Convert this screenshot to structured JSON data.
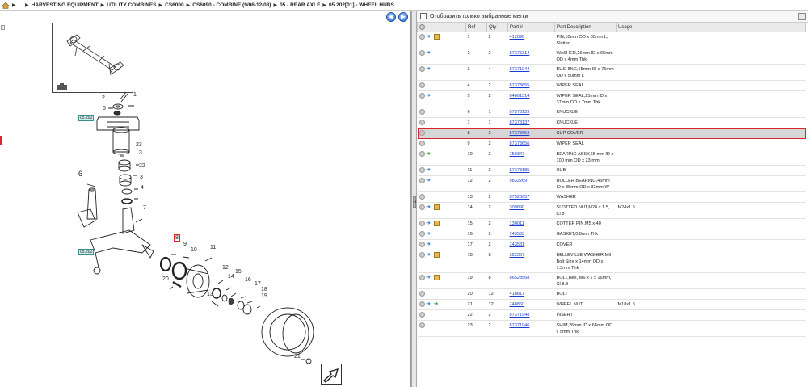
{
  "breadcrumb": {
    "prefix": "...",
    "items": [
      "HARVESTING EQUIPMENT",
      "UTILITY COMBINES",
      "CS6000",
      "CS6090 - COMBINE (9/06-12/08)",
      "05 - REAR AXLE",
      "05.202[01] - WHEEL HUBS"
    ]
  },
  "filter": {
    "label": "Отобразить только выбранные метки"
  },
  "table": {
    "columns": [
      "Ref",
      "Qty",
      "Part #",
      "Part Description",
      "Usage"
    ],
    "rows": [
      {
        "ref": "1",
        "qty": "2",
        "part": "412690",
        "desc": "PIN,10mm OD x 65mm L, Slotted",
        "usage": "",
        "icons": [
          "gray",
          "blue",
          "box"
        ]
      },
      {
        "ref": "2",
        "qty": "2",
        "part": "87375314",
        "desc": "WASHER,26mm ID x 65mm OD x 4mm Thk",
        "usage": "",
        "icons": [
          "gray",
          "blue"
        ]
      },
      {
        "ref": "3",
        "qty": "4",
        "part": "87371944",
        "desc": "BUSHING,65mm ID x 75mm OD x 50mm L",
        "usage": "",
        "icons": [
          "gray",
          "blue"
        ]
      },
      {
        "ref": "4",
        "qty": "2",
        "part": "87373655",
        "desc": "WIPER SEAL",
        "usage": "",
        "icons": [
          "gray"
        ]
      },
      {
        "ref": "5",
        "qty": "2",
        "part": "84801314",
        "desc": "WIPER SEAL,25mm ID x 37mm OD x 7mm Thk",
        "usage": "",
        "icons": [
          "gray",
          "blue"
        ]
      },
      {
        "ref": "6",
        "qty": "1",
        "part": "87373139",
        "desc": "KNUCKLE",
        "usage": "",
        "icons": [
          "gray"
        ]
      },
      {
        "ref": "7",
        "qty": "1",
        "part": "87373137",
        "desc": "KNUCKLE",
        "usage": "",
        "icons": [
          "gray"
        ]
      },
      {
        "ref": "8",
        "qty": "2",
        "part": "87373653",
        "desc": "CUP COVER",
        "usage": "",
        "icons": [
          "gray"
        ],
        "selected": true
      },
      {
        "ref": "9",
        "qty": "2",
        "part": "87373656",
        "desc": "WIPER SEAL",
        "usage": "",
        "icons": [
          "gray"
        ]
      },
      {
        "ref": "10",
        "qty": "2",
        "part": "750347",
        "desc": "BEARING ASSY,65 mm ID x 100 mm OD x 23 mm",
        "usage": "",
        "icons": [
          "gray",
          "green"
        ]
      },
      {
        "ref": "11",
        "qty": "2",
        "part": "87373185",
        "desc": "HUB",
        "usage": "",
        "icons": [
          "gray",
          "blue"
        ]
      },
      {
        "ref": "12",
        "qty": "2",
        "part": "9832269",
        "desc": "ROLLER BEARING,45mm ID x 85mm OD x 32mm W",
        "usage": "",
        "icons": [
          "gray",
          "blue"
        ]
      },
      {
        "ref": "13",
        "qty": "2",
        "part": "87520657",
        "desc": "WASHER",
        "usage": "",
        "icons": [
          "gray"
        ]
      },
      {
        "ref": "14",
        "qty": "2",
        "part": "309890",
        "desc": "SLOTTED NUT,M24 x 1.5, Cl 8",
        "usage": "M24x1.5",
        "icons": [
          "gray",
          "blue",
          "box"
        ]
      },
      {
        "ref": "15",
        "qty": "2",
        "part": "130011",
        "desc": "COTTER PIN,M5 x 40",
        "usage": "",
        "icons": [
          "gray",
          "blue",
          "box"
        ]
      },
      {
        "ref": "16",
        "qty": "2",
        "part": "743583",
        "desc": "GASKET,0.8mm Thk",
        "usage": "",
        "icons": [
          "gray",
          "blue"
        ]
      },
      {
        "ref": "17",
        "qty": "2",
        "part": "743581",
        "desc": "COVER",
        "usage": "",
        "icons": [
          "gray",
          "blue"
        ]
      },
      {
        "ref": "18",
        "qty": "8",
        "part": "322357",
        "desc": "BELLEVILLE WASHER,M6 Bolt Size x 14mm OD x 1.3mm Thk",
        "usage": "",
        "icons": [
          "gray",
          "blue",
          "box"
        ]
      },
      {
        "ref": "19",
        "qty": "8",
        "part": "86528568",
        "desc": "BOLT,Hex, M6 x 1 x 16mm, Cl 8.8",
        "usage": "",
        "icons": [
          "gray",
          "blue",
          "box"
        ]
      },
      {
        "ref": "20",
        "qty": "12",
        "part": "418817",
        "desc": "BOLT",
        "usage": "",
        "icons": [
          "gray"
        ]
      },
      {
        "ref": "21",
        "qty": "12",
        "part": "748860",
        "desc": "WHEEL NUT",
        "usage": "M18x1.5",
        "icons": [
          "gray",
          "blue",
          "green"
        ]
      },
      {
        "ref": "22",
        "qty": "2",
        "part": "87371948",
        "desc": "INSERT",
        "usage": "",
        "icons": [
          "gray"
        ]
      },
      {
        "ref": "23",
        "qty": "2",
        "part": "87371946",
        "desc": "SHIM,26mm ID x 64mm OD x 5mm Thk",
        "usage": "",
        "icons": [
          "gray"
        ]
      }
    ]
  },
  "diagram": {
    "callouts": [
      "1",
      "2",
      "3",
      "3",
      "4",
      "5",
      "6",
      "7",
      "8",
      "9",
      "10",
      "11",
      "12",
      "13",
      "14",
      "15",
      "16",
      "17",
      "18",
      "19",
      "20",
      "21",
      "22",
      "23"
    ],
    "ref_tags": [
      "05.202",
      "05.202"
    ]
  }
}
